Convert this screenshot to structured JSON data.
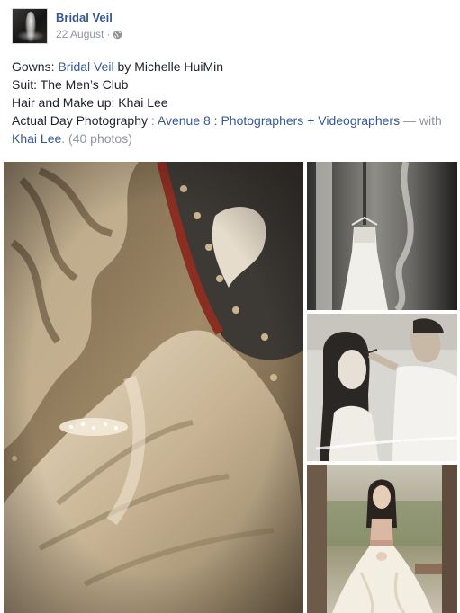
{
  "header": {
    "page_name": "Bridal Veil",
    "date": "22 August",
    "separator": "·",
    "privacy_icon": "globe-icon"
  },
  "post": {
    "line1": {
      "prefix": "Gowns: ",
      "link": "Bridal Veil",
      "suffix": " by Michelle HuiMin"
    },
    "line2": "Suit: The Men’s Club",
    "line3": "Hair and Make up: Khai Lee",
    "line4": {
      "prefix": "Actual Day Photography",
      "colon": " : ",
      "link": "Avenue 8 : Photographers + Videographers",
      "with": " — with"
    },
    "line5": {
      "tagged": "Khai Lee",
      "period": ".",
      "count": " (40 photos)"
    }
  },
  "photos": [
    {
      "subject": "gown-detail-photo"
    },
    {
      "subject": "hanging-dress-photo"
    },
    {
      "subject": "makeup-session-photo"
    },
    {
      "subject": "flower-girl-photo"
    }
  ],
  "colors": {
    "link": "#365899",
    "text": "#1d2129",
    "muted": "#90949c"
  }
}
